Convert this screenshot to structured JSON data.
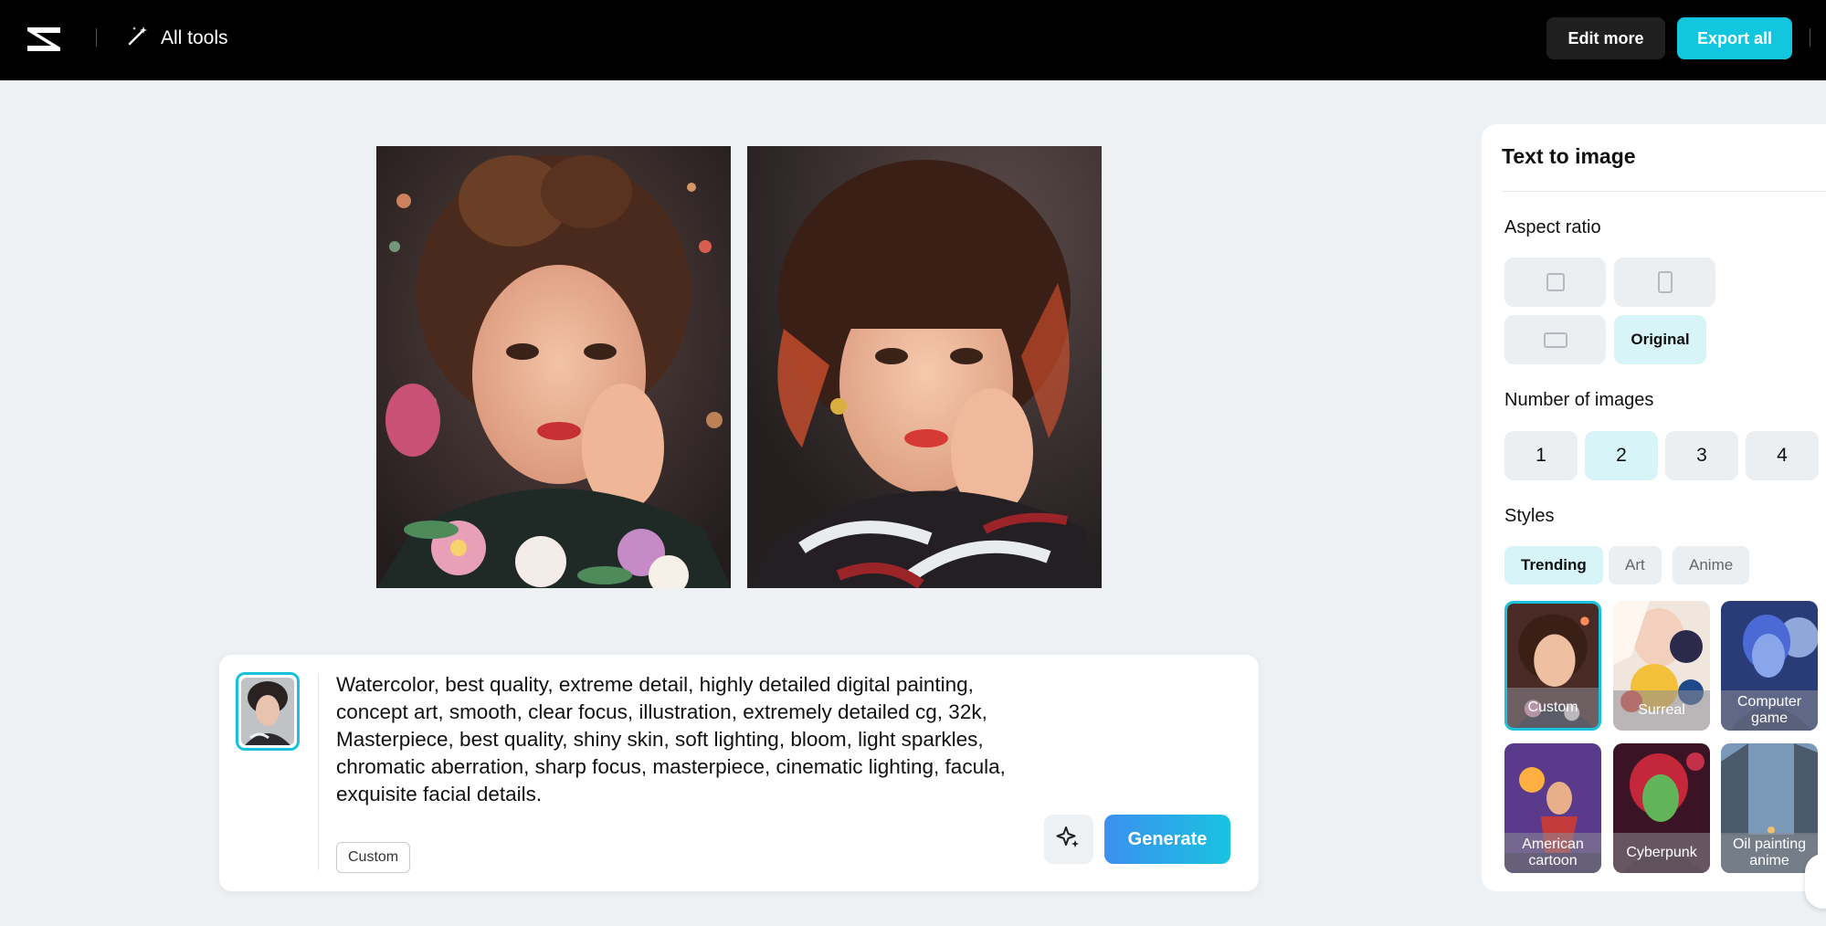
{
  "topbar": {
    "all_tools_label": "All tools",
    "edit_more_label": "Edit more",
    "export_all_label": "Export all"
  },
  "prompt": {
    "text": "Watercolor, best quality, extreme detail, highly detailed digital painting, concept art, smooth, clear focus, illustration, extremely detailed cg, 32k, Masterpiece, best quality, shiny skin, soft lighting, bloom, light sparkles, chromatic aberration, sharp focus, masterpiece, cinematic lighting, facula, exquisite facial details.",
    "style_tag": "Custom",
    "generate_label": "Generate"
  },
  "panel": {
    "title": "Text to image",
    "aspect_ratio_label": "Aspect ratio",
    "aspect_original_label": "Original",
    "num_images_label": "Number of images",
    "num_options": [
      "1",
      "2",
      "3",
      "4"
    ],
    "num_selected": "2",
    "styles_label": "Styles",
    "style_tabs": [
      "Trending",
      "Art",
      "Anime"
    ],
    "style_cards": [
      "Custom",
      "Surreal",
      "Computer game",
      "American cartoon",
      "Cyberpunk",
      "Oil painting anime"
    ]
  },
  "colors": {
    "accent": "#12c6e0",
    "selected_bg": "#d7f4f8",
    "topbar_bg": "#000000",
    "canvas_bg": "#eef1f4"
  }
}
